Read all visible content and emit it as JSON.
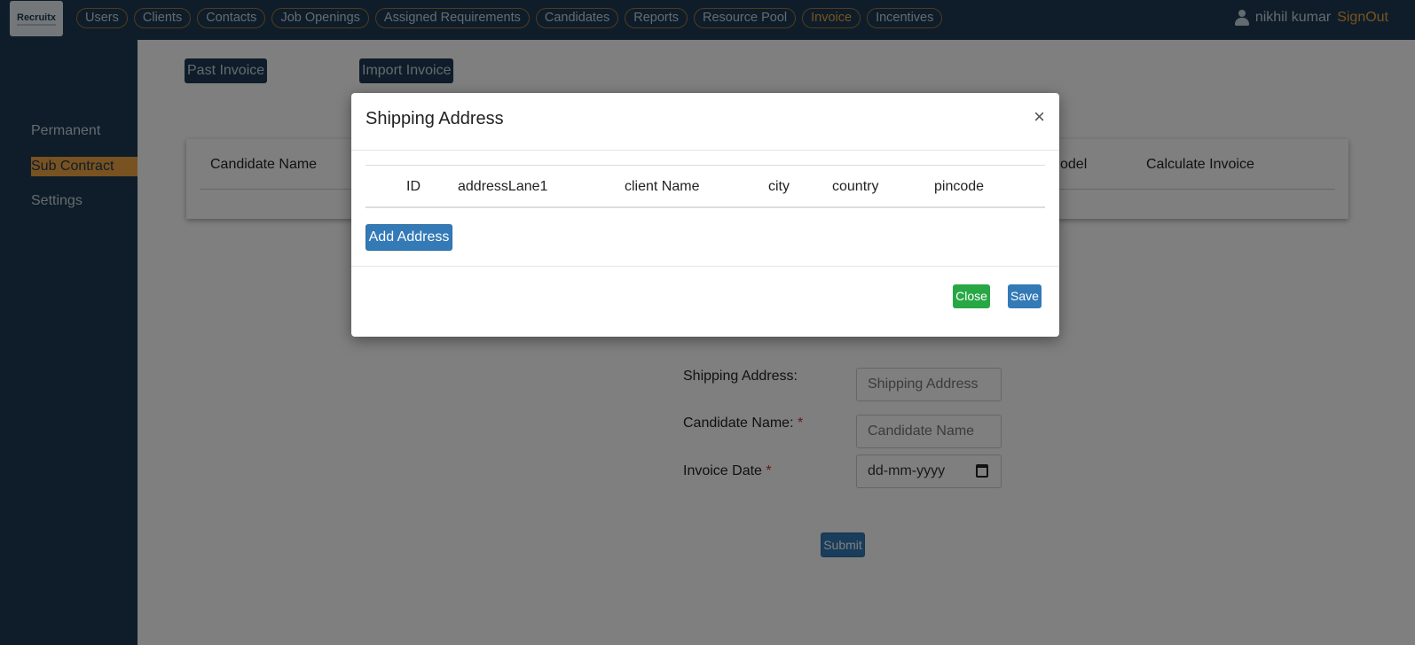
{
  "header": {
    "logo_text": "Recruitx",
    "nav": [
      {
        "label": "Users"
      },
      {
        "label": "Clients"
      },
      {
        "label": "Contacts"
      },
      {
        "label": "Job Openings"
      },
      {
        "label": "Assigned Requirements"
      },
      {
        "label": "Candidates"
      },
      {
        "label": "Reports"
      },
      {
        "label": "Resource Pool"
      },
      {
        "label": "Invoice",
        "active": true
      },
      {
        "label": "Incentives"
      }
    ],
    "user_name": "nikhil kumar",
    "signout_label": "SignOut"
  },
  "sidebar": {
    "items": [
      {
        "label": "Permanent"
      },
      {
        "label": "Sub Contract",
        "active": true
      },
      {
        "label": "Settings"
      }
    ]
  },
  "main": {
    "past_invoice_label": "Past Invoice",
    "import_invoice_label": "Import Invoice",
    "table_headers": [
      "Candidate Name",
      "odel",
      "Calculate Invoice"
    ],
    "form": {
      "shipping_label": "Shipping Address:",
      "shipping_placeholder": "Shipping Address",
      "candidate_label": "Candidate Name:",
      "candidate_placeholder": "Candidate Name",
      "date_label": "Invoice Date",
      "date_placeholder": "dd-mm-yyyy",
      "required_mark": "*",
      "submit_label": "Submit"
    }
  },
  "modal": {
    "title": "Shipping Address",
    "close_glyph": "×",
    "columns": [
      "ID",
      "addressLane1",
      "client Name",
      "city",
      "country",
      "pincode"
    ],
    "add_address_label": "Add Address",
    "close_label": "Close",
    "save_label": "Save"
  },
  "colors": {
    "navbar": "#1d3a52",
    "accent": "#f0a542",
    "primary": "#337ab7",
    "success": "#28a745"
  }
}
